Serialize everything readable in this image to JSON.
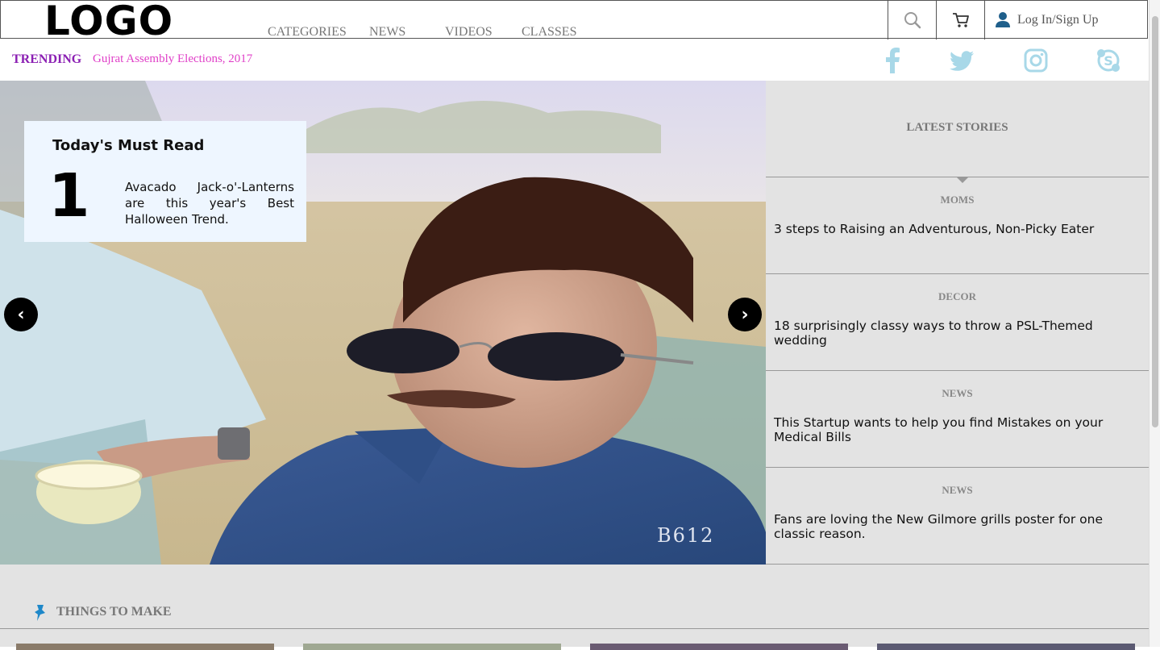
{
  "header": {
    "logo": "LOGO",
    "nav": [
      "CATEGORIES",
      "NEWS",
      "VIDEOS",
      "CLASSES"
    ],
    "login_label": "Log In/Sign Up",
    "icons": {
      "search": "search-icon",
      "cart": "cart-icon",
      "user": "user-icon"
    }
  },
  "trending": {
    "label": "TRENDING",
    "topic": "Gujrat Assembly Elections, 2017"
  },
  "social": [
    "facebook-icon",
    "twitter-icon",
    "instagram-icon",
    "skype-icon"
  ],
  "hero": {
    "must_read_title": "Today's Must Read",
    "number": "1",
    "text": "Avacado Jack-o'-Lanterns are this year's Best Halloween Trend.",
    "prev": "‹",
    "next": "›",
    "watermark": "B612"
  },
  "latest": {
    "title": "LATEST STORIES",
    "stories": [
      {
        "category": "MOMS",
        "title": "3 steps to Raising an Adventurous, Non-Picky Eater"
      },
      {
        "category": "DECOR",
        "title": "18 surprisingly classy ways to throw a PSL-Themed wedding"
      },
      {
        "category": "NEWS",
        "title": "This Startup wants to help you find Mistakes on your Medical Bills"
      },
      {
        "category": "NEWS",
        "title": "Fans are loving the New Gilmore grills poster for one classic reason."
      }
    ]
  },
  "things": {
    "title": "THINGS TO MAKE"
  },
  "colors": {
    "trending": "#8b1fb3",
    "topic": "#e040c8",
    "social": "#a8d8e8",
    "panel": "#e3e3e3"
  }
}
